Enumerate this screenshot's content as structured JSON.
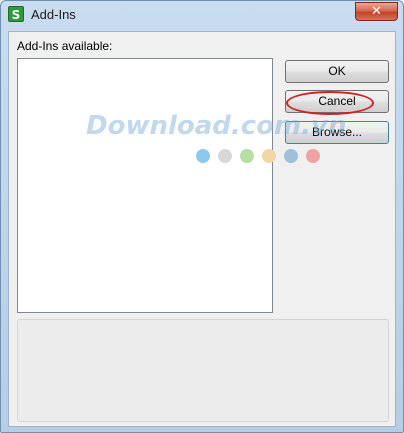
{
  "window": {
    "title": "Add-Ins",
    "app_icon_glyph": "S",
    "close_glyph": "✕"
  },
  "dialog": {
    "available_label": "Add-Ins available:",
    "ok_label": "OK",
    "cancel_label": "Cancel",
    "browse_label": "Browse..."
  },
  "watermark": {
    "text": "Download.com.vn",
    "dot_colors": [
      "#8ec8ef",
      "#d8d8d8",
      "#b8dfa3",
      "#f3d6a6",
      "#9ec0dc",
      "#f1a3a3"
    ]
  },
  "colors": {
    "annotation_circle": "#d02020",
    "title_bar": "#c9dcf0",
    "close_button": "#c0432a"
  }
}
